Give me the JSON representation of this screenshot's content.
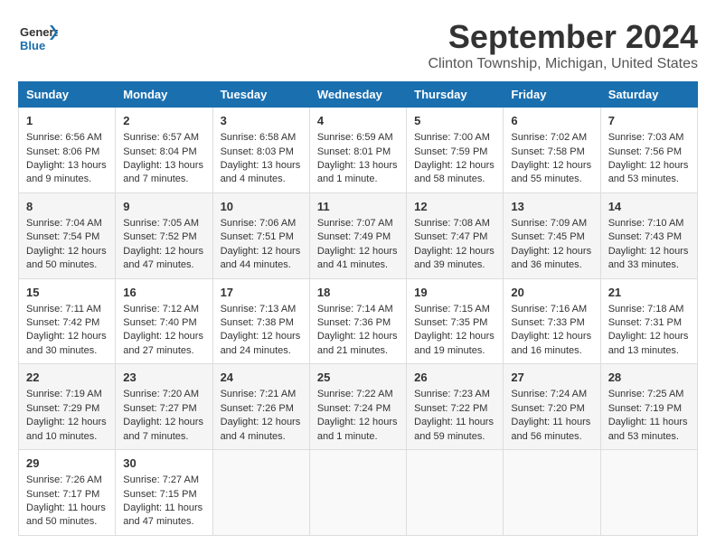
{
  "header": {
    "logo_general": "General",
    "logo_blue": "Blue",
    "month": "September 2024",
    "location": "Clinton Township, Michigan, United States"
  },
  "weekdays": [
    "Sunday",
    "Monday",
    "Tuesday",
    "Wednesday",
    "Thursday",
    "Friday",
    "Saturday"
  ],
  "weeks": [
    [
      {
        "day": 1,
        "sunrise": "6:56 AM",
        "sunset": "8:06 PM",
        "daylight": "13 hours and 9 minutes."
      },
      {
        "day": 2,
        "sunrise": "6:57 AM",
        "sunset": "8:04 PM",
        "daylight": "13 hours and 7 minutes."
      },
      {
        "day": 3,
        "sunrise": "6:58 AM",
        "sunset": "8:03 PM",
        "daylight": "13 hours and 4 minutes."
      },
      {
        "day": 4,
        "sunrise": "6:59 AM",
        "sunset": "8:01 PM",
        "daylight": "13 hours and 1 minute."
      },
      {
        "day": 5,
        "sunrise": "7:00 AM",
        "sunset": "7:59 PM",
        "daylight": "12 hours and 58 minutes."
      },
      {
        "day": 6,
        "sunrise": "7:02 AM",
        "sunset": "7:58 PM",
        "daylight": "12 hours and 55 minutes."
      },
      {
        "day": 7,
        "sunrise": "7:03 AM",
        "sunset": "7:56 PM",
        "daylight": "12 hours and 53 minutes."
      }
    ],
    [
      {
        "day": 8,
        "sunrise": "7:04 AM",
        "sunset": "7:54 PM",
        "daylight": "12 hours and 50 minutes."
      },
      {
        "day": 9,
        "sunrise": "7:05 AM",
        "sunset": "7:52 PM",
        "daylight": "12 hours and 47 minutes."
      },
      {
        "day": 10,
        "sunrise": "7:06 AM",
        "sunset": "7:51 PM",
        "daylight": "12 hours and 44 minutes."
      },
      {
        "day": 11,
        "sunrise": "7:07 AM",
        "sunset": "7:49 PM",
        "daylight": "12 hours and 41 minutes."
      },
      {
        "day": 12,
        "sunrise": "7:08 AM",
        "sunset": "7:47 PM",
        "daylight": "12 hours and 39 minutes."
      },
      {
        "day": 13,
        "sunrise": "7:09 AM",
        "sunset": "7:45 PM",
        "daylight": "12 hours and 36 minutes."
      },
      {
        "day": 14,
        "sunrise": "7:10 AM",
        "sunset": "7:43 PM",
        "daylight": "12 hours and 33 minutes."
      }
    ],
    [
      {
        "day": 15,
        "sunrise": "7:11 AM",
        "sunset": "7:42 PM",
        "daylight": "12 hours and 30 minutes."
      },
      {
        "day": 16,
        "sunrise": "7:12 AM",
        "sunset": "7:40 PM",
        "daylight": "12 hours and 27 minutes."
      },
      {
        "day": 17,
        "sunrise": "7:13 AM",
        "sunset": "7:38 PM",
        "daylight": "12 hours and 24 minutes."
      },
      {
        "day": 18,
        "sunrise": "7:14 AM",
        "sunset": "7:36 PM",
        "daylight": "12 hours and 21 minutes."
      },
      {
        "day": 19,
        "sunrise": "7:15 AM",
        "sunset": "7:35 PM",
        "daylight": "12 hours and 19 minutes."
      },
      {
        "day": 20,
        "sunrise": "7:16 AM",
        "sunset": "7:33 PM",
        "daylight": "12 hours and 16 minutes."
      },
      {
        "day": 21,
        "sunrise": "7:18 AM",
        "sunset": "7:31 PM",
        "daylight": "12 hours and 13 minutes."
      }
    ],
    [
      {
        "day": 22,
        "sunrise": "7:19 AM",
        "sunset": "7:29 PM",
        "daylight": "12 hours and 10 minutes."
      },
      {
        "day": 23,
        "sunrise": "7:20 AM",
        "sunset": "7:27 PM",
        "daylight": "12 hours and 7 minutes."
      },
      {
        "day": 24,
        "sunrise": "7:21 AM",
        "sunset": "7:26 PM",
        "daylight": "12 hours and 4 minutes."
      },
      {
        "day": 25,
        "sunrise": "7:22 AM",
        "sunset": "7:24 PM",
        "daylight": "12 hours and 1 minute."
      },
      {
        "day": 26,
        "sunrise": "7:23 AM",
        "sunset": "7:22 PM",
        "daylight": "11 hours and 59 minutes."
      },
      {
        "day": 27,
        "sunrise": "7:24 AM",
        "sunset": "7:20 PM",
        "daylight": "11 hours and 56 minutes."
      },
      {
        "day": 28,
        "sunrise": "7:25 AM",
        "sunset": "7:19 PM",
        "daylight": "11 hours and 53 minutes."
      }
    ],
    [
      {
        "day": 29,
        "sunrise": "7:26 AM",
        "sunset": "7:17 PM",
        "daylight": "11 hours and 50 minutes."
      },
      {
        "day": 30,
        "sunrise": "7:27 AM",
        "sunset": "7:15 PM",
        "daylight": "11 hours and 47 minutes."
      },
      null,
      null,
      null,
      null,
      null
    ]
  ],
  "labels": {
    "sunrise": "Sunrise:",
    "sunset": "Sunset:",
    "daylight": "Daylight:"
  }
}
